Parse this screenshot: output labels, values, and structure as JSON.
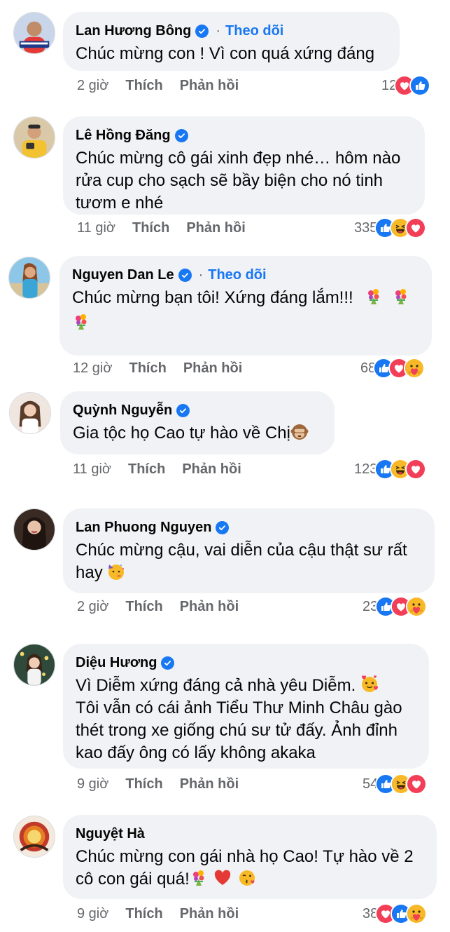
{
  "labels": {
    "like": "Thích",
    "reply": "Phản hồi",
    "follow": "Theo dõi",
    "dot": "·"
  },
  "colors": {
    "like_blue": "#1877f2",
    "love_red": "#f33e58",
    "haha_yellow": "#f7b928",
    "bubble_bg": "#f0f2f5",
    "meta_gray": "#65676b"
  },
  "comments": [
    {
      "name": "Lan Hương Bông",
      "verified": true,
      "follow": true,
      "text": [
        "Chúc mừng con ! Vì con quá xứng đáng"
      ],
      "time": "2 giờ",
      "count": "12",
      "reactions": [
        "love-icon",
        "like-icon"
      ]
    },
    {
      "name": "Lê Hồng Đăng",
      "verified": true,
      "follow": false,
      "text": [
        "Chúc mừng cô gái xinh đẹp nhé… hôm nào",
        "rửa cup cho sạch sẽ bầy biện cho nó tinh",
        "tươm e nhé"
      ],
      "time": "11 giờ",
      "count": "335",
      "reactions": [
        "like-icon",
        "haha-icon",
        "love-icon"
      ]
    },
    {
      "name": "Nguyen Dan Le",
      "verified": true,
      "follow": true,
      "text": [
        "Chúc mừng bạn tôi! Xứng đáng lắm!!!"
      ],
      "time": "12 giờ",
      "count": "68",
      "reactions": [
        "like-icon",
        "love-icon",
        "care-icon"
      ]
    },
    {
      "name": "Quỳnh Nguyễn",
      "verified": true,
      "follow": false,
      "text": [
        "Gia tộc họ Cao tự hào về Chị"
      ],
      "time": "11 giờ",
      "count": "123",
      "reactions": [
        "like-icon",
        "haha-icon",
        "love-icon"
      ]
    },
    {
      "name": "Lan Phuong Nguyen",
      "verified": true,
      "follow": false,
      "text": [
        "Chúc mừng cậu, vai diễn của cậu thật sư rất",
        "hay"
      ],
      "time": "2 giờ",
      "count": "23",
      "reactions": [
        "like-icon",
        "love-icon",
        "care-icon"
      ]
    },
    {
      "name": "Diệu Hương",
      "verified": true,
      "follow": false,
      "text": [
        "Vì Diễm xứng đáng cả nhà yêu Diễm.",
        "Tôi vẫn có cái ảnh Tiểu Thư Minh Châu gào",
        "thét trong xe giống chú sư tử đấy. Ảnh đỉnh",
        "kao đấy ông có lấy không akaka"
      ],
      "time": "9 giờ",
      "count": "54",
      "reactions": [
        "like-icon",
        "haha-icon",
        "love-icon"
      ]
    },
    {
      "name": "Nguyệt Hà",
      "verified": false,
      "follow": false,
      "text": [
        "Chúc mừng con gái nhà họ Cao! Tự hào về 2",
        "cô con gái quá!"
      ],
      "time": "9 giờ",
      "count": "38",
      "reactions": [
        "love-icon",
        "like-icon",
        "care-icon"
      ]
    }
  ]
}
